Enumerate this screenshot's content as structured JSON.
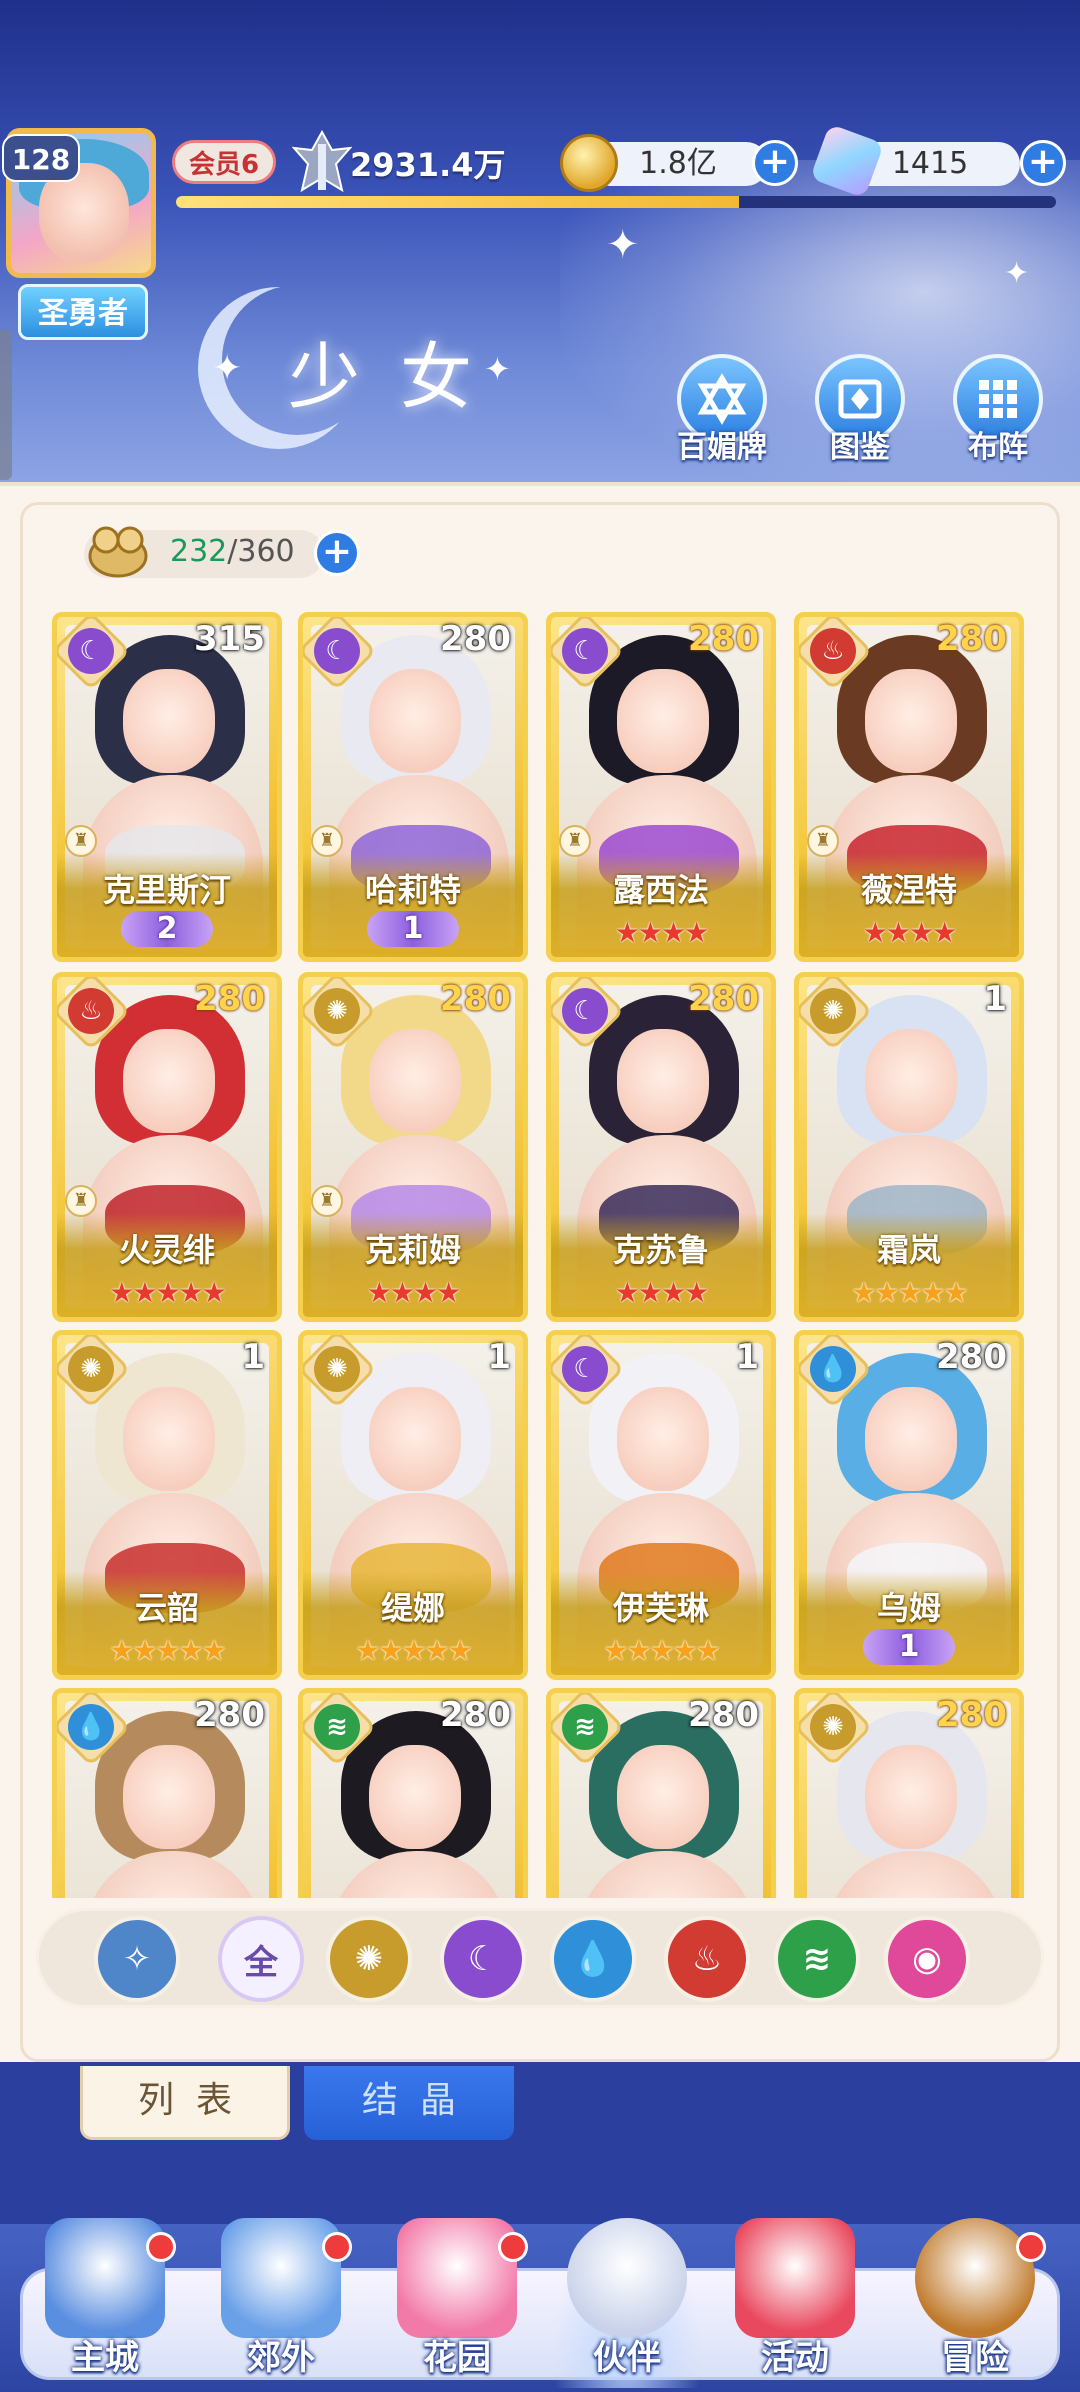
{
  "player": {
    "level": "128",
    "title": "圣勇者",
    "vip": "会员6",
    "power": "2931.4万",
    "gold": "1.8亿",
    "gems": "1415",
    "exp_fraction": 0.64
  },
  "page": {
    "title": "少女",
    "quick_buttons": [
      {
        "label": "百媚牌",
        "icon": "card-deck-icon"
      },
      {
        "label": "图鉴",
        "icon": "book-icon"
      },
      {
        "label": "布阵",
        "icon": "grid-formation-icon"
      }
    ]
  },
  "roster": {
    "current": "232",
    "max": "/360"
  },
  "cards": [
    {
      "name": "克里斯汀",
      "level": "315",
      "level_style": "white",
      "element": "moon",
      "role": true,
      "awaken": "2",
      "stars": 0,
      "star_color": "",
      "hair": "#2b2f48",
      "cloth": "#e6e6ea"
    },
    {
      "name": "哈莉特",
      "level": "280",
      "level_style": "white",
      "element": "moon",
      "role": true,
      "awaken": "1",
      "stars": 0,
      "star_color": "",
      "hair": "#e9e9f2",
      "cloth": "#8e66d8"
    },
    {
      "name": "露西法",
      "level": "280",
      "level_style": "gold",
      "element": "moon",
      "role": true,
      "awaken": "",
      "stars": 4,
      "star_color": "red",
      "hair": "#1c1a26",
      "cloth": "#9c4ad0"
    },
    {
      "name": "薇涅特",
      "level": "280",
      "level_style": "gold",
      "element": "fire",
      "role": true,
      "awaken": "",
      "stars": 4,
      "star_color": "red",
      "hair": "#6a3b22",
      "cloth": "#c8262e"
    },
    {
      "name": "火灵绯",
      "level": "280",
      "level_style": "gold",
      "element": "fire",
      "role": true,
      "awaken": "",
      "stars": 5,
      "star_color": "red",
      "hair": "#d12f34",
      "cloth": "#c0242a"
    },
    {
      "name": "克莉姆",
      "level": "280",
      "level_style": "gold",
      "element": "sun",
      "role": true,
      "awaken": "",
      "stars": 4,
      "star_color": "red",
      "hair": "#f2d98a",
      "cloth": "#b68ae8"
    },
    {
      "name": "克苏鲁",
      "level": "280",
      "level_style": "gold",
      "element": "moon",
      "role": false,
      "awaken": "",
      "stars": 4,
      "star_color": "red",
      "hair": "#2a2236",
      "cloth": "#3a2c5a"
    },
    {
      "name": "霜岚",
      "level": "1",
      "level_style": "white",
      "element": "sun",
      "role": false,
      "awaken": "",
      "stars": 5,
      "star_color": "gold",
      "hair": "#d8e2f2",
      "cloth": "#9fb5c8"
    },
    {
      "name": "云韶",
      "level": "1",
      "level_style": "white",
      "element": "sun",
      "role": false,
      "awaken": "",
      "stars": 5,
      "star_color": "gold",
      "hair": "#efe6d2",
      "cloth": "#c8302e"
    },
    {
      "name": "缇娜",
      "level": "1",
      "level_style": "white",
      "element": "sun",
      "role": false,
      "awaken": "",
      "stars": 5,
      "star_color": "gold",
      "hair": "#eeeef4",
      "cloth": "#e7b63a"
    },
    {
      "name": "伊芙琳",
      "level": "1",
      "level_style": "white",
      "element": "moon",
      "role": false,
      "awaken": "",
      "stars": 5,
      "star_color": "gold",
      "hair": "#f1f1f6",
      "cloth": "#e07a1e"
    },
    {
      "name": "乌姆",
      "level": "280",
      "level_style": "white",
      "element": "water",
      "role": false,
      "awaken": "1",
      "stars": 0,
      "star_color": "",
      "hair": "#5aaee6",
      "cloth": "#f4f4f8"
    },
    {
      "name": "",
      "level": "280",
      "level_style": "white",
      "element": "water",
      "role": false,
      "awaken": "",
      "stars": 0,
      "star_color": "",
      "hair": "#b58a5c",
      "cloth": "#f0e8dc"
    },
    {
      "name": "",
      "level": "280",
      "level_style": "white",
      "element": "wind",
      "role": false,
      "awaken": "",
      "stars": 0,
      "star_color": "",
      "hair": "#1e1a22",
      "cloth": "#3b9a4a"
    },
    {
      "name": "",
      "level": "280",
      "level_style": "white",
      "element": "wind",
      "role": false,
      "awaken": "",
      "stars": 0,
      "star_color": "",
      "hair": "#2a6e62",
      "cloth": "#7fc8a8"
    },
    {
      "name": "",
      "level": "280",
      "level_style": "gold",
      "element": "sun",
      "role": false,
      "awaken": "",
      "stars": 0,
      "star_color": "",
      "hair": "#e6e6ee",
      "cloth": "#f2d3c8"
    }
  ],
  "filters": [
    {
      "id": "special",
      "label": "",
      "icon": "wing-icon",
      "color": "#4f86c9"
    },
    {
      "id": "all",
      "label": "全",
      "icon": "all-icon",
      "color": "#f5f0ff"
    },
    {
      "id": "sun",
      "label": "",
      "icon": "sun-icon",
      "color": "#c79b2c"
    },
    {
      "id": "moon",
      "label": "",
      "icon": "moon-icon",
      "color": "#8a4ccf"
    },
    {
      "id": "water",
      "label": "",
      "icon": "water-drop-icon",
      "color": "#2f8fd8"
    },
    {
      "id": "fire",
      "label": "",
      "icon": "fire-icon",
      "color": "#d23b32"
    },
    {
      "id": "wind",
      "label": "",
      "icon": "wind-icon",
      "color": "#2fa04a"
    },
    {
      "id": "light",
      "label": "",
      "icon": "orb-icon",
      "color": "#e0489a"
    }
  ],
  "tabs": {
    "list": "列表",
    "crystal": "结晶"
  },
  "nav": [
    {
      "label": "主城",
      "icon": "castle-icon",
      "dot": true
    },
    {
      "label": "郊外",
      "icon": "portal-icon",
      "dot": true
    },
    {
      "label": "花园",
      "icon": "heart-icon",
      "dot": true
    },
    {
      "label": "伙伴",
      "icon": "partner-portrait-icon",
      "dot": false,
      "active": true
    },
    {
      "label": "活动",
      "icon": "gift-box-icon",
      "dot": false
    },
    {
      "label": "冒险",
      "icon": "compass-icon",
      "dot": true
    }
  ],
  "colors": {
    "accent_blue": "#2f7ce3",
    "card_gold": "#f3c63b",
    "panel_bg": "#fbf4ec"
  }
}
